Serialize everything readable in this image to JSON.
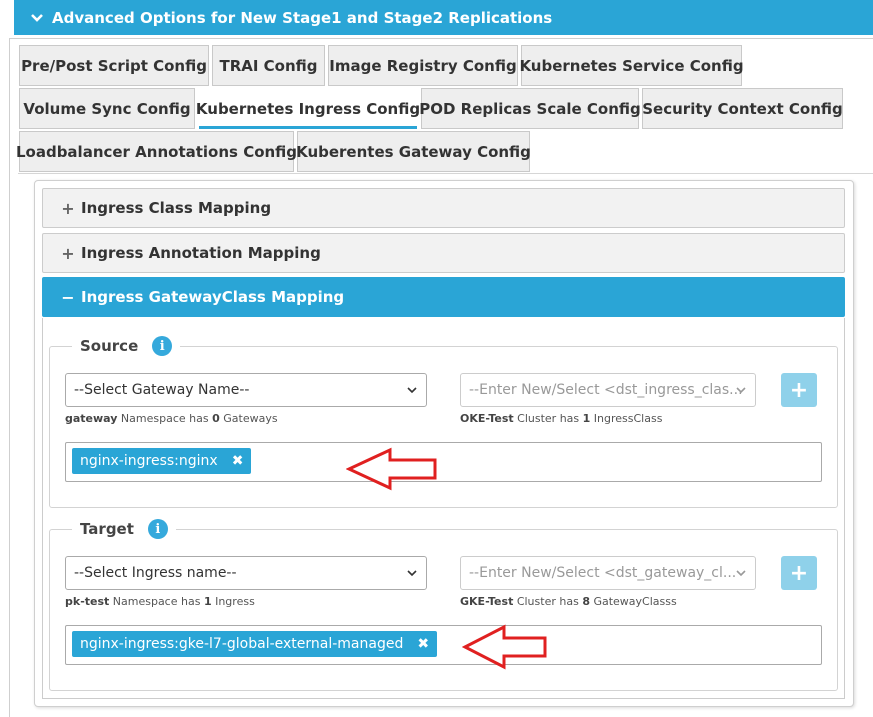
{
  "header": {
    "title": "Advanced Options for New Stage1 and Stage2 Replications"
  },
  "tabs": [
    {
      "label": "Pre/Post Script Config"
    },
    {
      "label": "TRAI Config"
    },
    {
      "label": "Image Registry Config"
    },
    {
      "label": "Kubernetes Service Config"
    },
    {
      "label": "Volume Sync Config"
    },
    {
      "label": "Kubernetes Ingress Config",
      "active": true
    },
    {
      "label": "POD Replicas Scale Config"
    },
    {
      "label": "Security Context Config"
    },
    {
      "label": "Loadbalancer Annotations Config"
    },
    {
      "label": "Kuberentes Gateway Config"
    }
  ],
  "accordion": [
    {
      "sign": "+",
      "label": "Ingress Class Mapping"
    },
    {
      "sign": "+",
      "label": "Ingress Annotation Mapping"
    },
    {
      "sign": "−",
      "label": "Ingress GatewayClass Mapping",
      "active": true
    }
  ],
  "source": {
    "legend": "Source",
    "select_value": "--Select Gateway Name--",
    "select_placeholder": "--Enter New/Select <dst_ingress_clas...",
    "helper_left_bold": "gateway",
    "helper_left_text": " Namespace has ",
    "helper_left_count": "0",
    "helper_left_suffix": " Gateways",
    "helper_right_bold": "OKE-Test",
    "helper_right_text": " Cluster has ",
    "helper_right_count": "1",
    "helper_right_suffix": " IngressClass",
    "tag": "nginx-ingress:nginx"
  },
  "target": {
    "legend": "Target",
    "select_value": "--Select Ingress name--",
    "select_placeholder": "--Enter New/Select <dst_gateway_cl...",
    "helper_left_bold": "pk-test",
    "helper_left_text": " Namespace has ",
    "helper_left_count": "1",
    "helper_left_suffix": " Ingress",
    "helper_right_bold": "GKE-Test",
    "helper_right_text": " Cluster has ",
    "helper_right_count": "8",
    "helper_right_suffix": " GatewayClasss",
    "tag": "nginx-ingress:gke-l7-global-external-managed"
  },
  "icons": {
    "add": "+",
    "remove": "✖",
    "info": "i"
  },
  "colors": {
    "accent": "#2aa5d6",
    "arrow": "#e02020",
    "add_button": "#8fd1ea"
  }
}
